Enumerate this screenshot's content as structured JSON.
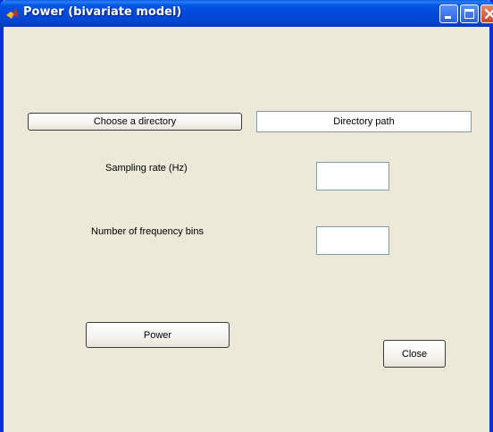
{
  "window": {
    "title": "Power (bivariate model)"
  },
  "buttons": {
    "choose_directory": "Choose a directory",
    "power": "Power",
    "close": "Close"
  },
  "fields": {
    "directory_path": "Directory path",
    "sampling_rate_value": "",
    "frequency_bins_value": ""
  },
  "labels": {
    "sampling_rate": "Sampling rate (Hz)",
    "frequency_bins": "Number of frequency bins"
  },
  "icons": {
    "app": "matlab-icon",
    "minimize": "minimize-icon",
    "maximize": "maximize-icon",
    "close": "close-icon"
  },
  "colors": {
    "titlebar": "#0055e5",
    "window_bg": "#ece9d8",
    "close_button": "#c8452b"
  }
}
